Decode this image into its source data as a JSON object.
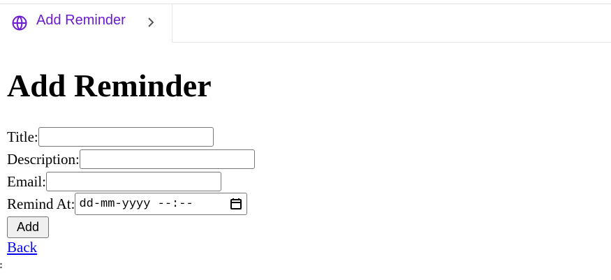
{
  "tab": {
    "label": "Add Reminder",
    "icon": "globe-icon",
    "accent": "#6a1bd1"
  },
  "heading": "Add Reminder",
  "form": {
    "title_label": "Title:",
    "title_value": "",
    "description_label": "Description:",
    "description_value": "",
    "email_label": "Email:",
    "email_value": "",
    "remind_label": "Remind At:",
    "remind_placeholder": "dd-mm-yyyy --:--",
    "add_button": "Add"
  },
  "back_link": "Back"
}
